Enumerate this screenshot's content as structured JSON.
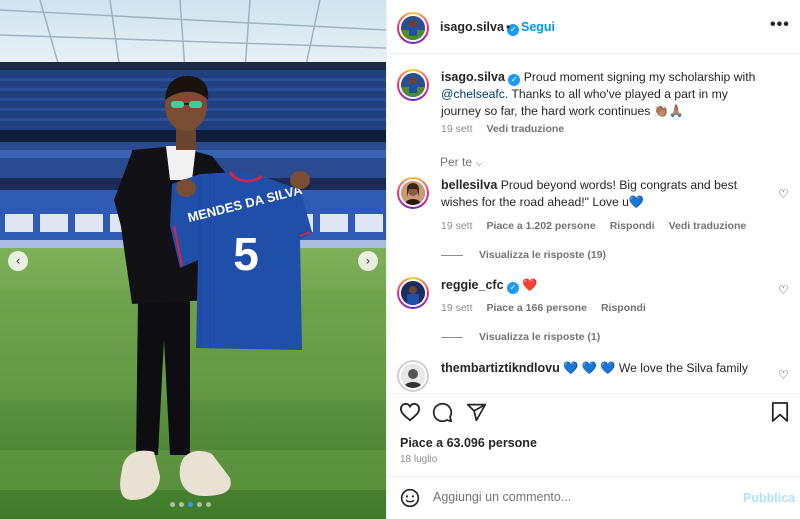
{
  "colors": {
    "accent": "#0095f6",
    "verified": "#1d9bf0",
    "heart_red": "#ed4956",
    "blue_heart": "#3d7dd8",
    "jersey": "#1f4fa8"
  },
  "media": {
    "jersey_name": "MENDES DA SILVA",
    "jersey_number": "5",
    "prev_icon": "chevron-left-icon",
    "next_icon": "chevron-right-icon",
    "slide_count": 5,
    "active_slide": 2
  },
  "header": {
    "username": "isago.silva",
    "separator": "•",
    "follow_label": "Segui",
    "more_label": "•••"
  },
  "caption": {
    "username": "isago.silva",
    "text_before_mention": "Proud moment signing my scholarship with ",
    "mention": "@chelseafc",
    "text_after_mention": ". Thanks to all who've played a part in my journey so far, the hard work continues 👏🏽🙏🏽",
    "time": "19 sett",
    "translate": "Vedi traduzione"
  },
  "for_you_label": "Per te",
  "comments": [
    {
      "username": "bellesilva",
      "text": "Proud beyond words! Big congrats and best wishes for the road ahead!\" Love u💙",
      "time": "19 sett",
      "likes": "Piace a 1.202 persone",
      "reply": "Rispondi",
      "translate": "Vedi traduzione",
      "view_replies": "Visualizza le risposte (19)"
    },
    {
      "username": "reggie_cfc",
      "text": "❤️",
      "time": "19 sett",
      "likes": "Piace a 166 persone",
      "reply": "Rispondi",
      "view_replies": "Visualizza le risposte (1)"
    },
    {
      "username": "thembartiztikndlovu",
      "text": "💙 💙 💙 We love the Silva family"
    }
  ],
  "actions": {
    "like_icon": "heart-outline-icon",
    "comment_icon": "comment-bubble-icon",
    "share_icon": "paper-plane-icon",
    "save_icon": "bookmark-icon",
    "likes_text": "Piace a 63.096 persone",
    "date": "18 luglio"
  },
  "comment_box": {
    "emoji_icon": "emoji-icon",
    "placeholder": "Aggiungi un commento...",
    "publish_label": "Pubblica"
  }
}
